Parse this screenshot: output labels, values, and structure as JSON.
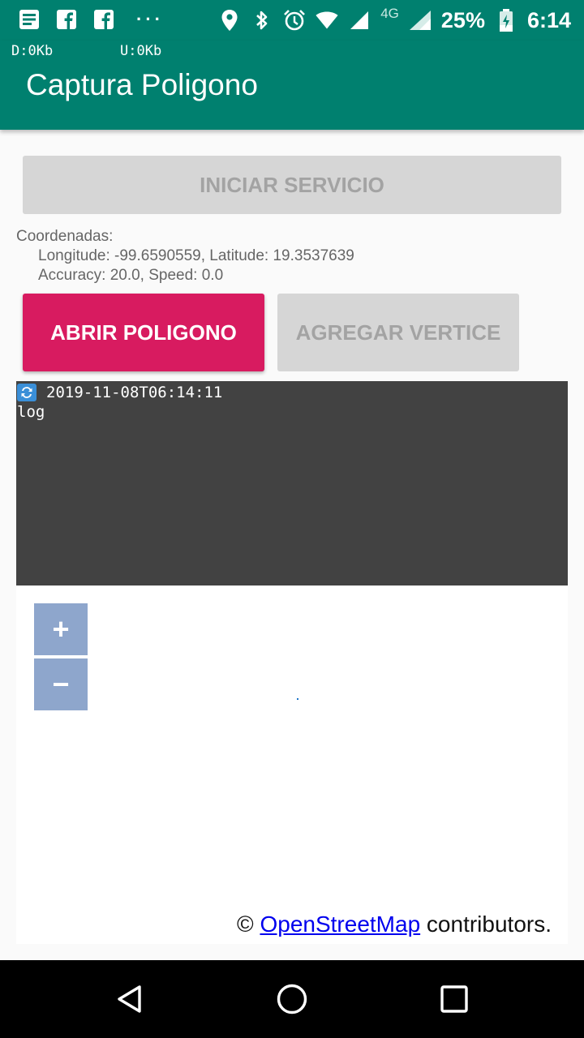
{
  "status_bar": {
    "left_icons": [
      "notes-icon",
      "facebook-icon",
      "facebook-icon"
    ],
    "dots": "···",
    "right_icons": [
      "location-icon",
      "bluetooth-icon",
      "alarm-icon",
      "wifi-icon",
      "signal-icon"
    ],
    "network_label": "4G",
    "battery_percent": "25%",
    "time": "6:14"
  },
  "app_bar": {
    "download_label": "D:0Kb",
    "upload_label": "U:0Kb",
    "title": "Captura Poligono",
    "color": "#00806f"
  },
  "buttons": {
    "start_service": "INICIAR SERVICIO",
    "open_polygon": "ABRIR POLIGONO",
    "add_vertex": "AGREGAR VERTICE",
    "accent_color": "#d81b60"
  },
  "coordinates": {
    "heading": "Coordenadas:",
    "line1": "Longitude: -99.6590559, Latitude: 19.3537639",
    "line2": "Accuracy: 20.0, Speed: 0.0"
  },
  "log": {
    "timestamp": "2019-11-08T06:14:11",
    "text": "log"
  },
  "map": {
    "zoom_in": "+",
    "zoom_out": "−",
    "attribution_prefix": "© ",
    "attribution_link": "OpenStreetMap",
    "attribution_suffix": " contributors."
  },
  "nav_bar": {
    "icons": [
      "back-icon",
      "home-icon",
      "recents-icon"
    ]
  }
}
